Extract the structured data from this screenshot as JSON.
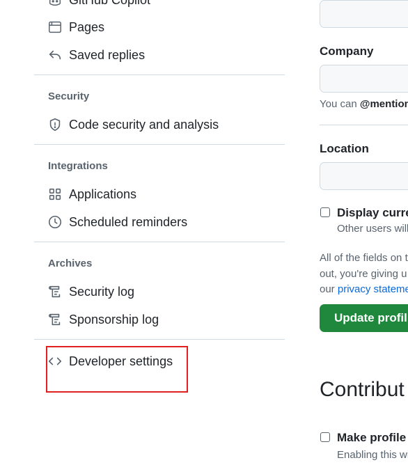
{
  "sidebar": {
    "items": [
      {
        "label": "GitHub Copilot",
        "icon": "copilot-icon"
      },
      {
        "label": "Pages",
        "icon": "browser-icon"
      },
      {
        "label": "Saved replies",
        "icon": "reply-icon"
      },
      {
        "label": "Code security and analysis",
        "icon": "shield-icon"
      },
      {
        "label": "Applications",
        "icon": "apps-icon"
      },
      {
        "label": "Scheduled reminders",
        "icon": "clock-icon"
      },
      {
        "label": "Security log",
        "icon": "log-icon"
      },
      {
        "label": "Sponsorship log",
        "icon": "log-icon"
      },
      {
        "label": "Developer settings",
        "icon": "code-icon"
      }
    ],
    "sections": {
      "security": "Security",
      "integrations": "Integrations",
      "archives": "Archives"
    }
  },
  "form": {
    "company_label": "Company",
    "company_note_prefix": "You can ",
    "company_note_mention": "@mention",
    "location_label": "Location",
    "display_time_label": "Display curre",
    "display_time_note": "Other users will",
    "privacy_line1": "All of the fields on t",
    "privacy_line2": "out, you're giving u",
    "privacy_line3_prefix": "our ",
    "privacy_link": "privacy stateme",
    "update_button": "Update profil",
    "contrib_title": "Contribut",
    "make_profile_label": "Make profile",
    "make_profile_note": "Enabling this wi"
  },
  "colors": {
    "highlight_border": "#e02020",
    "primary_button": "#1f883d",
    "link": "#0969da"
  }
}
